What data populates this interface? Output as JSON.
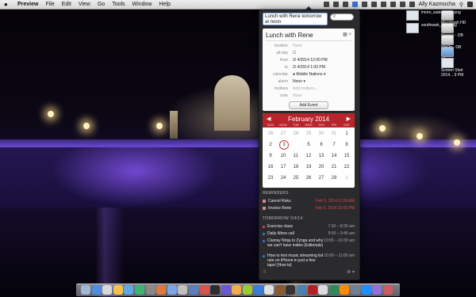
{
  "menubar": {
    "app": "Preview",
    "items": [
      "File",
      "Edit",
      "View",
      "Go",
      "Tools",
      "Window",
      "Help"
    ],
    "user": "Ally Kazmucha"
  },
  "desktop": {
    "icons": [
      {
        "label": "imore_watermar....png",
        "kind": "image"
      },
      {
        "label": "southwark_bri...r.jpg",
        "kind": "image"
      },
      {
        "label": "Macintosh HD",
        "kind": "drive"
      },
      {
        "label": "iVerses - DB",
        "kind": "drive"
      },
      {
        "label": "iPhOn - DB",
        "kind": "drive"
      },
      {
        "label": "iMore",
        "kind": "folder"
      },
      {
        "label": "Screen Shot 2014....9 PM",
        "kind": "image"
      }
    ]
  },
  "fantastical": {
    "input_value": "Lunch with Rene tomorrow at noon",
    "event": {
      "title": "Lunch with Rene",
      "fields": [
        {
          "key": "location",
          "value": "None",
          "placeholder": true
        },
        {
          "key": "all-day",
          "value": "☐",
          "placeholder": false
        },
        {
          "key": "from",
          "value": "2/ 4/2014  12:00 PM",
          "placeholder": false
        },
        {
          "key": "to",
          "value": "2/ 4/2014   1:00 PM",
          "placeholder": false
        },
        {
          "key": "calendar",
          "value": "● Mobile Nations ▾",
          "placeholder": false
        },
        {
          "key": "alarm",
          "value": "None ▾",
          "placeholder": false
        },
        {
          "key": "invitees",
          "value": "Add invitees...",
          "placeholder": true
        },
        {
          "key": "note",
          "value": "None",
          "placeholder": true
        }
      ],
      "add_button": "Add Event"
    },
    "calendar": {
      "month": "February 2014",
      "weekdays": [
        "SUN",
        "MON",
        "TUE",
        "WED",
        "THU",
        "FRI",
        "SAT"
      ],
      "weeks": [
        [
          "26",
          "27",
          "28",
          "29",
          "30",
          "31",
          "1"
        ],
        [
          "2",
          "3",
          "4",
          "5",
          "6",
          "7",
          "8"
        ],
        [
          "9",
          "10",
          "11",
          "12",
          "13",
          "14",
          "15"
        ],
        [
          "16",
          "17",
          "18",
          "19",
          "20",
          "21",
          "22"
        ],
        [
          "23",
          "24",
          "25",
          "26",
          "27",
          "28",
          "1"
        ]
      ],
      "today": "4",
      "selected": "3"
    },
    "reminders_header": "REMINDERS",
    "reminders": [
      {
        "title": "Cancel Roku",
        "date": "Feb 5, 2014 11:59 AM"
      },
      {
        "title": "Invoice Rene",
        "date": "Feb 5, 2014 10:00 PM"
      }
    ],
    "tomorrow_header": "TOMORROW  2/4/14",
    "events": [
      {
        "title": "Exercise class",
        "time": "7:30 – 8:30 am",
        "color": "#d94a4a"
      },
      {
        "title": "Daily iMore call",
        "time": "9:00 – 9:45 am",
        "color": "#3c7bd9"
      },
      {
        "title": "Clumsy Ninja to Zynga and why we can't have indies (Editorials)",
        "time": "10:00 – 10:30 am",
        "color": "#3c7bd9"
      },
      {
        "title": "How to text music streaming list rate on iPhone in just a few taps! [How to]",
        "time": "10:00 – 11:00 am",
        "color": "#3c7bd9"
      }
    ],
    "footer_left": "⇩",
    "footer_right": "⚙ ▾"
  },
  "colors": {
    "accent_red": "#b8242b",
    "accent_blue": "#3c7bd9"
  }
}
